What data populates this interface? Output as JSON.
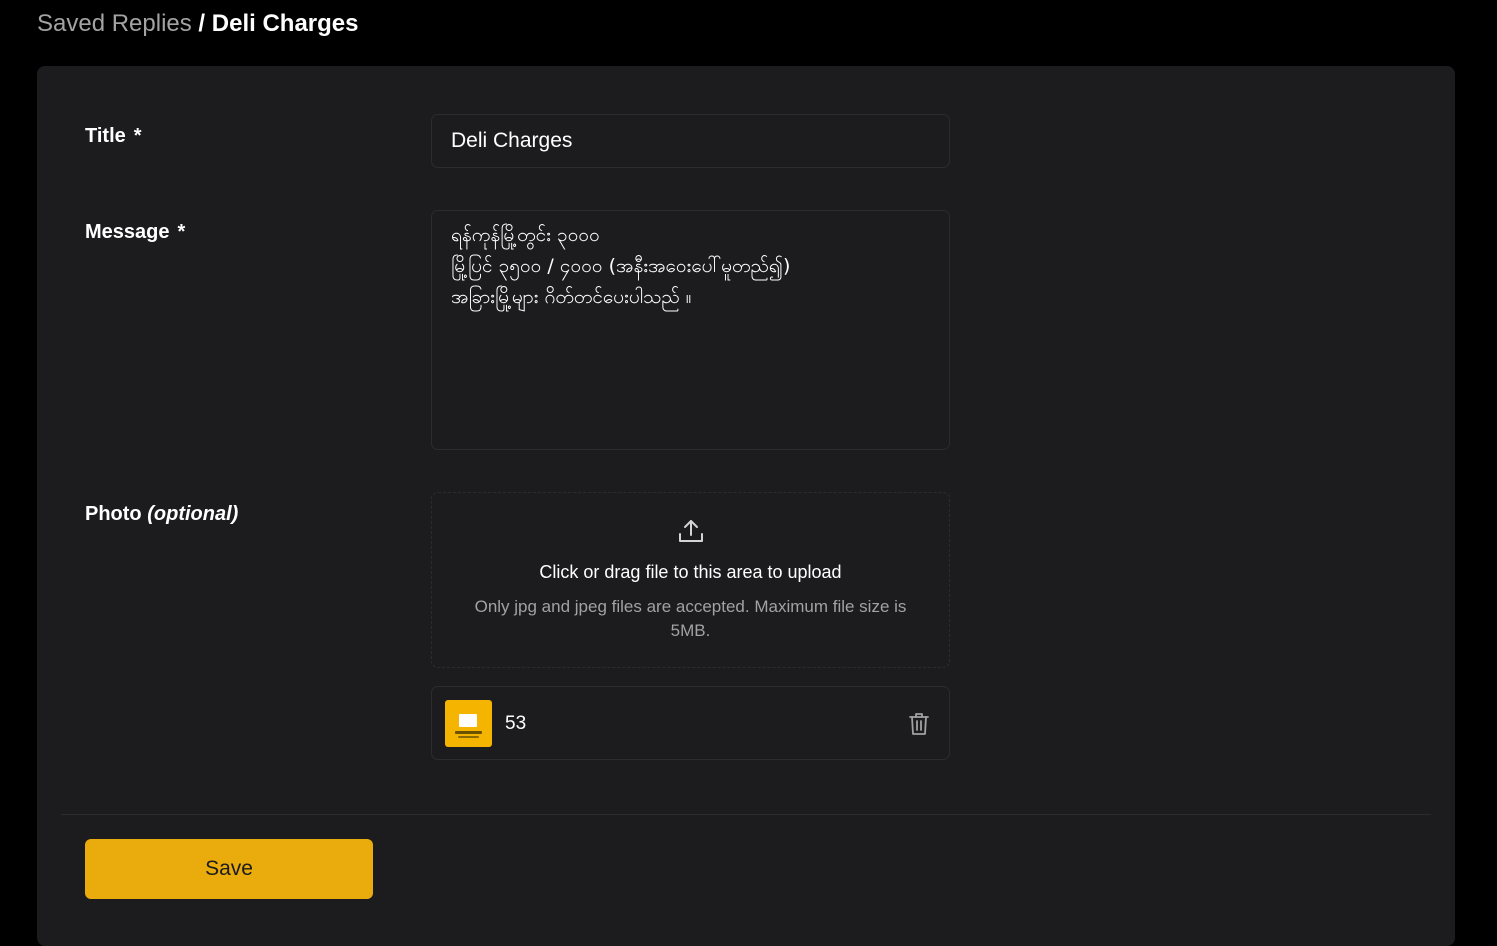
{
  "breadcrumb": {
    "parent": "Saved Replies",
    "separator": " / ",
    "current": "Deli Charges"
  },
  "form": {
    "title": {
      "label": "Title",
      "required_marker": "*",
      "value": "Deli Charges"
    },
    "message": {
      "label": "Message",
      "required_marker": "*",
      "value": "ရန်ကုန်မြို့တွင်း ၃၀၀၀\nမြို့ပြင် ၃၅၀၀ / ၄၀၀၀ (အနီးအဝေးပေါ်မူတည်၍)\nအခြားမြို့များ ဂိတ်တင်ပေးပါသည် ။"
    },
    "photo": {
      "label": "Photo",
      "optional_text": "(optional)",
      "upload_title": "Click or drag file to this area to upload",
      "upload_hint": "Only jpg and jpeg files are accepted. Maximum file size is 5MB.",
      "upload_icon": "upload-icon",
      "file": {
        "name": "53",
        "delete_icon": "trash-icon"
      }
    },
    "save_label": "Save"
  },
  "colors": {
    "background": "#000000",
    "card": "#1c1c1e",
    "border": "#2c2c2f",
    "accent": "#eaab0c",
    "muted_text": "#a1a1a6"
  }
}
